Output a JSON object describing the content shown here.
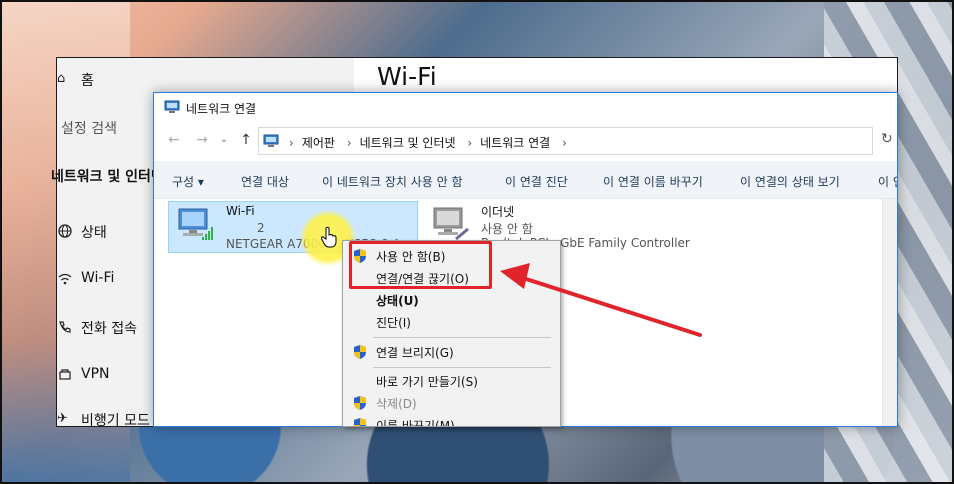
{
  "settings": {
    "home_label": "홈",
    "search_placeholder": "설정 검색",
    "section_title": "네트워크 및 인터넷",
    "items": [
      {
        "label": "상태",
        "icon": "globe-icon"
      },
      {
        "label": "Wi-Fi",
        "icon": "wifi-icon"
      },
      {
        "label": "전화 접속",
        "icon": "phone-icon"
      },
      {
        "label": "VPN",
        "icon": "vpn-icon"
      },
      {
        "label": "비행기 모드",
        "icon": "airplane-icon"
      }
    ],
    "page_title": "Wi-Fi"
  },
  "netwin": {
    "title": "네트워크 연결",
    "breadcrumbs": [
      "제어판",
      "네트워크 및 인터넷",
      "네트워크 연결"
    ],
    "commands": [
      "구성 ▾",
      "연결 대상",
      "이 네트워크 장치 사용 안 함",
      "이 연결 진단",
      "이 연결 이름 바꾸기",
      "이 연결의 상태 보기",
      "이 연"
    ],
    "adapters": [
      {
        "name": "Wi-Fi",
        "status": "2",
        "device": "NETGEAR A7000 ... USB3.0 A..."
      },
      {
        "name": "이더넷",
        "status": "사용 안 함",
        "device": "Realtek PCIe GbE Family Controller"
      }
    ]
  },
  "context_menu": {
    "items": [
      {
        "label": "사용 안 함(B)",
        "shield": true
      },
      {
        "label": "연결/연결 끊기(O)",
        "shield": false
      },
      {
        "label": "상태(U)",
        "shield": false,
        "bold": true
      },
      {
        "label": "진단(I)",
        "shield": false
      },
      {
        "label": "연결 브리지(G)",
        "shield": true
      },
      {
        "label": "바로 가기 만들기(S)",
        "shield": false
      },
      {
        "label": "삭제(D)",
        "shield": true,
        "disabled": true
      },
      {
        "label": "이름 바꾸기(M)",
        "shield": true
      }
    ]
  },
  "colors": {
    "accent": "#2a7ad6",
    "selection": "#cce8ff",
    "annotation_red": "#e0242a",
    "cursor_highlight": "#fff35a"
  }
}
